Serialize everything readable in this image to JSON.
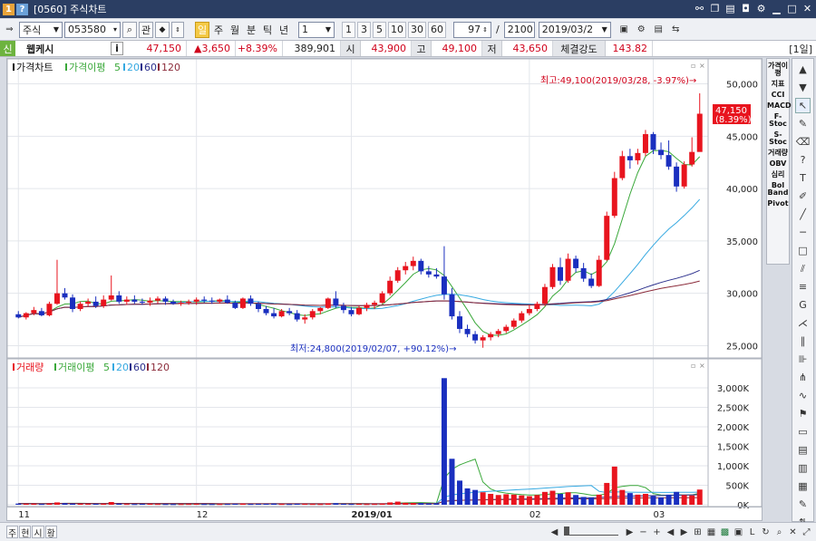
{
  "window": {
    "title": "[0560] 주식차트",
    "icon1": "1",
    "icon2": "?"
  },
  "toolbar": {
    "market": "주식",
    "code": "053580",
    "search_label": "관",
    "periods": [
      "일",
      "주",
      "월",
      "분",
      "틱",
      "년"
    ],
    "selected_period": "일",
    "interval_value": "1",
    "quick_values": [
      "1",
      "3",
      "5",
      "10",
      "30",
      "60"
    ],
    "count_value": "97",
    "total_value": "2100",
    "date_value": "2019/03/2"
  },
  "quote": {
    "badge": "신",
    "name": "웹케시",
    "info_label": "i",
    "price": "47,150",
    "change": "▲3,650",
    "change_pct": "+8.39%",
    "volume": "389,901",
    "open_label": "시",
    "open": "43,900",
    "high_label": "고",
    "high": "49,100",
    "low_label": "저",
    "low": "43,650",
    "strength_label": "체결강도",
    "strength": "143.82",
    "unit": "[1일]"
  },
  "price_panel": {
    "legend": {
      "title": "가격차트",
      "ma_label": "가격이평",
      "ma_values": [
        "5",
        "20",
        "60",
        "120"
      ]
    },
    "high_annotation": "최고:49,100(2019/03/28, -3.97%)→",
    "low_annotation": "최저:24,800(2019/02/07, +90.12%)→",
    "last_price_label": "47,150",
    "last_pct_label": "(8.39%)"
  },
  "volume_panel": {
    "legend": {
      "title": "거래량",
      "ma_label": "거래이평",
      "ma_values": [
        "5",
        "20",
        "60",
        "120"
      ]
    }
  },
  "right_panel": {
    "items": [
      "가격이평",
      "지표",
      "CCI",
      "MACD",
      "F-Stoc",
      "S-Stoc",
      "거래량",
      "OBV",
      "심리",
      "Bol Band",
      "Pivot"
    ]
  },
  "bottom": {
    "tabs": [
      "주",
      "현",
      "시",
      "황"
    ]
  },
  "colors": {
    "up": "#e8141e",
    "down": "#1a2fbf",
    "ma5": "#3aa83a",
    "ma20": "#36a9e1",
    "ma60": "#2a2e8c",
    "ma120": "#8b2b3a",
    "grid": "#e3e6eb"
  },
  "chart_data": [
    {
      "type": "candlestick",
      "title": "가격차트",
      "x_tick_labels": [
        "11",
        "12",
        "2019/01",
        "02",
        "03"
      ],
      "y_tick_labels": [
        "25,000",
        "30,000",
        "35,000",
        "40,000",
        "45,000",
        "50,000"
      ],
      "ylim": [
        24000,
        51000
      ],
      "ohlc": [
        [
          28000,
          28300,
          27600,
          27700
        ],
        [
          27700,
          28200,
          27500,
          28100
        ],
        [
          28100,
          28700,
          27900,
          28400
        ],
        [
          28300,
          28600,
          27800,
          27900
        ],
        [
          27900,
          29200,
          27800,
          29000
        ],
        [
          29000,
          33200,
          28900,
          30000
        ],
        [
          30000,
          30500,
          29400,
          29600
        ],
        [
          29600,
          29900,
          28200,
          28500
        ],
        [
          28500,
          29200,
          28300,
          29000
        ],
        [
          29000,
          29500,
          28700,
          29200
        ],
        [
          29200,
          29700,
          28600,
          28800
        ],
        [
          28800,
          29800,
          28600,
          29400
        ],
        [
          29400,
          31700,
          29300,
          29800
        ],
        [
          29800,
          30200,
          29000,
          29200
        ],
        [
          29200,
          29700,
          28900,
          29400
        ],
        [
          29400,
          29800,
          29000,
          29200
        ],
        [
          29200,
          29500,
          28900,
          29100
        ],
        [
          29100,
          29600,
          28800,
          29300
        ],
        [
          29300,
          29700,
          29000,
          29500
        ],
        [
          29500,
          29700,
          28900,
          29200
        ],
        [
          29200,
          29400,
          28900,
          29000
        ],
        [
          29000,
          29300,
          28800,
          29100
        ],
        [
          29100,
          29400,
          28900,
          29200
        ],
        [
          29200,
          29600,
          28900,
          29400
        ],
        [
          29400,
          29700,
          29100,
          29300
        ],
        [
          29300,
          29600,
          29000,
          29200
        ],
        [
          29200,
          29500,
          29000,
          29400
        ],
        [
          29400,
          29800,
          29000,
          29100
        ],
        [
          29100,
          29300,
          28500,
          28600
        ],
        [
          28600,
          29600,
          28500,
          29500
        ],
        [
          29500,
          29800,
          28800,
          29000
        ],
        [
          29000,
          29200,
          28200,
          28500
        ],
        [
          28500,
          28800,
          27900,
          28100
        ],
        [
          28100,
          28600,
          27600,
          27800
        ],
        [
          27800,
          28500,
          27700,
          28300
        ],
        [
          28300,
          28600,
          27900,
          28100
        ],
        [
          28100,
          28400,
          27300,
          27500
        ],
        [
          27500,
          28000,
          27100,
          27700
        ],
        [
          27700,
          28500,
          27500,
          28300
        ],
        [
          28300,
          28700,
          28000,
          28600
        ],
        [
          28600,
          29600,
          28500,
          29500
        ],
        [
          29500,
          30200,
          28600,
          28800
        ],
        [
          28800,
          29100,
          28100,
          28400
        ],
        [
          28400,
          28700,
          27800,
          28000
        ],
        [
          28000,
          28800,
          27900,
          28600
        ],
        [
          28600,
          29100,
          28300,
          28900
        ],
        [
          28900,
          29300,
          28500,
          29100
        ],
        [
          29100,
          30200,
          29000,
          30000
        ],
        [
          30000,
          31600,
          29800,
          31200
        ],
        [
          31200,
          32500,
          31000,
          32200
        ],
        [
          32200,
          33000,
          31800,
          32600
        ],
        [
          32600,
          33500,
          32200,
          33100
        ],
        [
          33100,
          33300,
          31800,
          32100
        ],
        [
          32100,
          32600,
          31500,
          31800
        ],
        [
          31800,
          32400,
          31400,
          31600
        ],
        [
          31600,
          34500,
          29400,
          29900
        ],
        [
          29900,
          30500,
          27500,
          27800
        ],
        [
          27800,
          28300,
          26200,
          26600
        ],
        [
          26600,
          27000,
          25800,
          26100
        ],
        [
          26100,
          26400,
          25200,
          25500
        ],
        [
          25500,
          26000,
          24800,
          25800
        ],
        [
          25800,
          26300,
          25500,
          26100
        ],
        [
          26100,
          26600,
          25800,
          26400
        ],
        [
          26400,
          27000,
          26200,
          26800
        ],
        [
          26800,
          27600,
          26600,
          27400
        ],
        [
          27400,
          28300,
          27200,
          28100
        ],
        [
          28100,
          28900,
          27900,
          28500
        ],
        [
          28500,
          29200,
          28300,
          29000
        ],
        [
          29000,
          30900,
          28800,
          30600
        ],
        [
          30600,
          32800,
          30400,
          32500
        ],
        [
          32500,
          33400,
          30800,
          31200
        ],
        [
          31200,
          33800,
          31000,
          33300
        ],
        [
          33300,
          33600,
          32000,
          32400
        ],
        [
          32400,
          32900,
          31100,
          31400
        ],
        [
          31400,
          31900,
          30500,
          30700
        ],
        [
          30700,
          33600,
          30600,
          33200
        ],
        [
          33200,
          37800,
          33100,
          37400
        ],
        [
          37400,
          41600,
          37200,
          41000
        ],
        [
          41000,
          43600,
          40800,
          43100
        ],
        [
          43100,
          43800,
          41900,
          42700
        ],
        [
          42700,
          43800,
          42300,
          43400
        ],
        [
          43400,
          45600,
          43100,
          45200
        ],
        [
          45200,
          45400,
          43300,
          43700
        ],
        [
          43700,
          44400,
          42800,
          43200
        ],
        [
          43200,
          44600,
          41800,
          42100
        ],
        [
          42100,
          42500,
          39700,
          40200
        ],
        [
          40200,
          42600,
          40000,
          42300
        ],
        [
          42300,
          44900,
          42100,
          43500
        ],
        [
          43500,
          49100,
          43650,
          47150
        ]
      ]
    },
    {
      "type": "bar",
      "title": "거래량",
      "y_tick_labels": [
        "0K",
        "500K",
        "1,000K",
        "1,500K",
        "2,000K",
        "2,500K",
        "3,000K"
      ],
      "ylim": [
        0,
        3350
      ],
      "unit": "K",
      "values": [
        30,
        25,
        28,
        20,
        35,
        60,
        40,
        30,
        25,
        22,
        24,
        28,
        70,
        30,
        20,
        18,
        22,
        25,
        20,
        18,
        16,
        18,
        20,
        22,
        19,
        17,
        18,
        20,
        25,
        30,
        20,
        22,
        24,
        30,
        20,
        18,
        25,
        22,
        20,
        18,
        35,
        40,
        25,
        20,
        22,
        18,
        20,
        30,
        60,
        80,
        50,
        45,
        40,
        30,
        35,
        3250,
        1180,
        620,
        420,
        380,
        320,
        280,
        250,
        270,
        260,
        240,
        220,
        250,
        330,
        360,
        280,
        320,
        250,
        200,
        180,
        260,
        560,
        980,
        380,
        300,
        260,
        280,
        220,
        190,
        260,
        330,
        250,
        240,
        389.9
      ]
    }
  ]
}
